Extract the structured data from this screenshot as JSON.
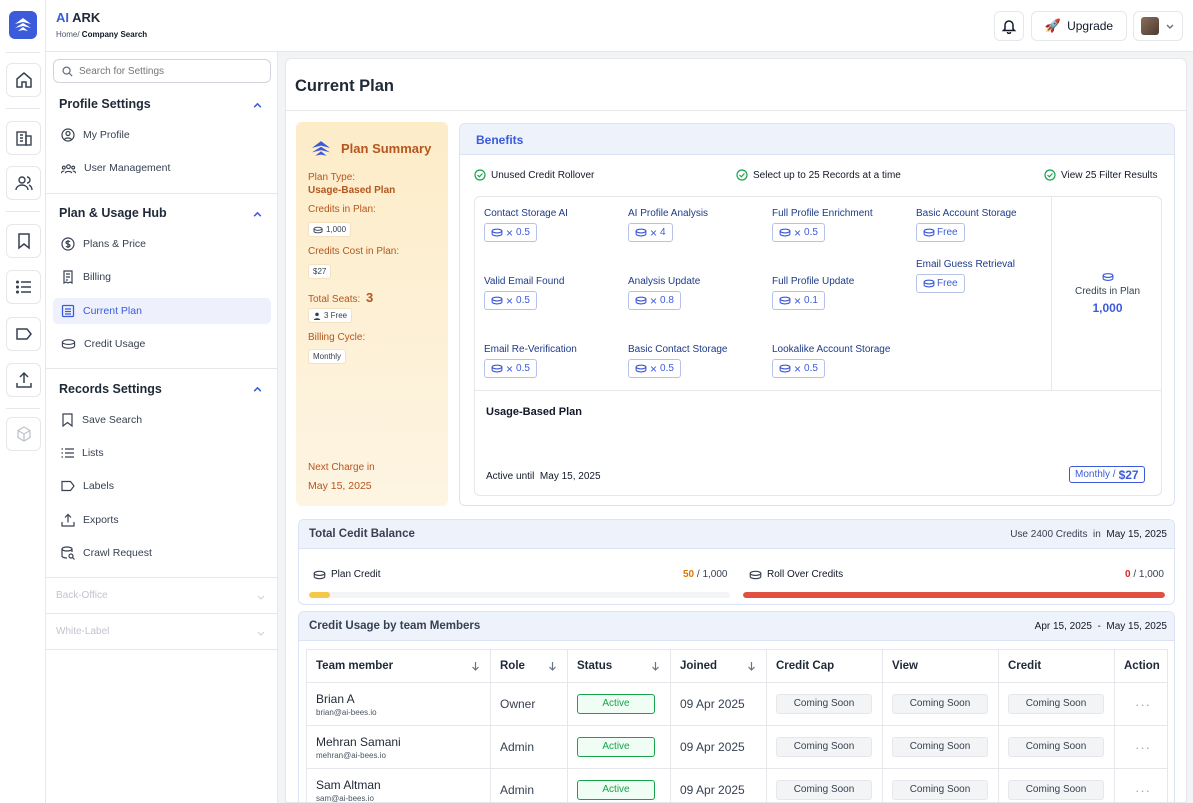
{
  "app": {
    "brand_prefix": "AI",
    "brand_name": "ARK",
    "breadcrumb_home": "Home/",
    "breadcrumb_current": "Company Search"
  },
  "header": {
    "upgrade_label": "Upgrade"
  },
  "sidebar": {
    "search_placeholder": "Search for Settings",
    "profile_settings": {
      "title": "Profile Settings",
      "items": [
        "My Profile",
        "User Management"
      ]
    },
    "plan_usage": {
      "title": "Plan & Usage Hub",
      "items": [
        "Plans & Price",
        "Billing",
        "Current Plan",
        "Credit Usage"
      ]
    },
    "records_settings": {
      "title": "Records Settings",
      "items": [
        "Save Search",
        "Lists",
        "Labels",
        "Exports",
        "Crawl Request"
      ]
    },
    "back_office": "Back-Office",
    "white_label": "White-Label"
  },
  "page": {
    "title": "Current Plan"
  },
  "summary": {
    "title": "Plan Summary",
    "plan_type_label": "Plan Type:",
    "plan_type_value": "Usage-Based Plan",
    "credits_label": "Credits in Plan:",
    "credits_value": "1,000",
    "cost_label": "Credits Cost in Plan:",
    "cost_value": "$27",
    "seats_label": "Total Seats:",
    "seats_value": "3",
    "seats_free": "3 Free",
    "billing_label": "Billing Cycle:",
    "billing_value": "Monthly",
    "next_charge_label": "Next Charge in",
    "next_charge_value": "May 15, 2025"
  },
  "benefits": {
    "title": "Benefits",
    "checks": [
      "Unused Credit Rollover",
      "Select up to 25 Records at a time",
      "View 25 Filter Results"
    ],
    "items": [
      {
        "name": "Contact Storage AI",
        "cost": "0.5",
        "mult": true
      },
      {
        "name": "AI Profile Analysis",
        "cost": "4",
        "mult": true
      },
      {
        "name": "Full Profile Enrichment",
        "cost": "0.5",
        "mult": true
      },
      {
        "name": "Basic Account Storage",
        "cost": "Free",
        "mult": false
      },
      {
        "name": "Valid Email Found",
        "cost": "0.5",
        "mult": true
      },
      {
        "name": "Analysis Update",
        "cost": "0.8",
        "mult": true
      },
      {
        "name": "Full Profile Update",
        "cost": "0.1",
        "mult": true
      },
      {
        "name": "Email Guess Retrieval",
        "cost": "Free",
        "mult": false
      },
      {
        "name": "Email Re-Verification",
        "cost": "0.5",
        "mult": true
      },
      {
        "name": "Basic Contact Storage",
        "cost": "0.5",
        "mult": true
      },
      {
        "name": "Lookalike Account Storage",
        "cost": "0.5",
        "mult": true
      }
    ],
    "credits_in_plan_label": "Credits in Plan",
    "credits_in_plan_value": "1,000",
    "plan_name": "Usage-Based Plan",
    "active_until_label": "Active until",
    "active_until_value": "May 15, 2025",
    "billing_cycle": "Monthly /",
    "price": "$27"
  },
  "balance": {
    "title": "Total Cedit Balance",
    "use_text": "Use 2400 Credits",
    "in_label": "in",
    "date": "May 15, 2025",
    "plan_credit_label": "Plan Credit",
    "plan_credit_used": "50",
    "plan_credit_total": "/ 1,000",
    "plan_credit_fraction": 0.05,
    "rollover_label": "Roll Over Credits",
    "rollover_used": "0",
    "rollover_total": "/ 1,000",
    "colors": {
      "plan": "#f5c84c",
      "rollover": "#e05141"
    }
  },
  "usage": {
    "title": "Credit Usage by team Members",
    "range_start": "Apr 15, 2025",
    "range_sep": "-",
    "range_end": "May 15, 2025",
    "columns": [
      "Team member",
      "Role",
      "Status",
      "Joined",
      "Credit Cap",
      "View",
      "Credit",
      "Action"
    ],
    "rows": [
      {
        "name": "Brian A",
        "email": "brian@ai-bees.io",
        "role": "Owner",
        "status": "Active",
        "joined": "09 Apr 2025",
        "cap": "Coming Soon",
        "view": "Coming Soon",
        "credit": "Coming Soon",
        "action": "···"
      },
      {
        "name": "Mehran Samani",
        "email": "mehran@ai-bees.io",
        "role": "Admin",
        "status": "Active",
        "joined": "09 Apr 2025",
        "cap": "Coming Soon",
        "view": "Coming Soon",
        "credit": "Coming Soon",
        "action": "···"
      },
      {
        "name": "Sam Altman",
        "email": "sam@ai-bees.io",
        "role": "Admin",
        "status": "Active",
        "joined": "09 Apr 2025",
        "cap": "Coming Soon",
        "view": "Coming Soon",
        "credit": "Coming Soon",
        "action": "···"
      }
    ]
  }
}
